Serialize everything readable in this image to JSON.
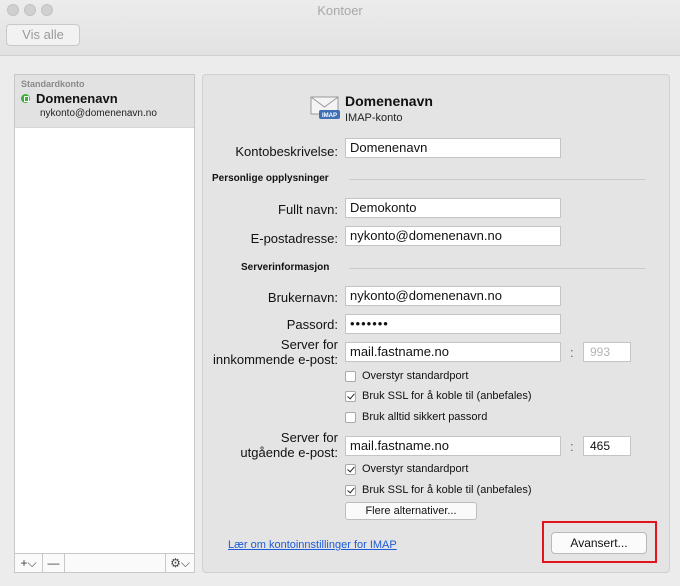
{
  "window": {
    "title": "Kontoer",
    "show_all": "Vis alle"
  },
  "sidebar": {
    "section": "Standardkonto",
    "account_name": "Domenenavn",
    "account_email": "nykonto@domenenavn.no",
    "add_label": "+⌵",
    "remove_label": "—",
    "gear_label": "⚙⌵"
  },
  "header": {
    "name": "Domenenavn",
    "type": "IMAP-konto",
    "icon": "mail-envelope-icon"
  },
  "fields": {
    "description_label": "Kontobeskrivelse:",
    "description_value": "Domenenavn",
    "personal_section": "Personlige opplysninger",
    "fullname_label": "Fullt navn:",
    "fullname_value": "Demokonto",
    "email_label": "E-postadresse:",
    "email_value": "nykonto@domenenavn.no",
    "server_section": "Serverinformasjon",
    "username_label": "Brukernavn:",
    "username_value": "nykonto@domenenavn.no",
    "password_label": "Passord:",
    "password_value": "•••••••",
    "incoming_label_1": "Server for",
    "incoming_label_2": "innkommende e-post:",
    "incoming_value": "mail.fastname.no",
    "incoming_port": "993",
    "outgoing_label_1": "Server for",
    "outgoing_label_2": "utgående e-post:",
    "outgoing_value": "mail.fastname.no",
    "outgoing_port": "465"
  },
  "checkboxes": {
    "in_override": {
      "label": "Overstyr standardport",
      "checked": false
    },
    "in_ssl": {
      "label": "Bruk SSL for å koble til (anbefales)",
      "checked": true
    },
    "in_secure_pw": {
      "label": "Bruk alltid sikkert passord",
      "checked": false
    },
    "out_override": {
      "label": "Overstyr standardport",
      "checked": true
    },
    "out_ssl": {
      "label": "Bruk SSL for å koble til (anbefales)",
      "checked": true
    }
  },
  "buttons": {
    "more_options": "Flere alternativer...",
    "advanced": "Avansert...",
    "help_link": "Lær om kontoinnstillinger for IMAP"
  }
}
